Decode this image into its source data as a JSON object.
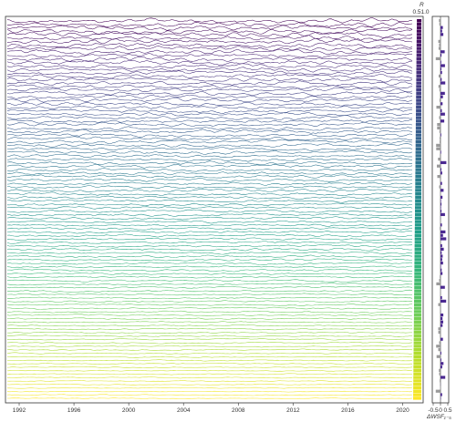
{
  "chart_data": [
    {
      "type": "line",
      "title": "",
      "xlabel": "",
      "ylabel": "",
      "x_ticks": [
        "1992",
        "1996",
        "2000",
        "2004",
        "2008",
        "2012",
        "2016",
        "2020"
      ],
      "x_range": [
        1991,
        2021.5
      ],
      "series_count": 110,
      "colormap": "viridis",
      "colormap_stops": [
        "#440154",
        "#482878",
        "#3e4989",
        "#31688e",
        "#26828e",
        "#1f9e89",
        "#35b779",
        "#6ece58",
        "#b5de2b",
        "#fde725"
      ]
    },
    {
      "type": "bar",
      "orientation": "horizontal",
      "title_label": "R",
      "ticks": [
        "0.5",
        "1.0"
      ],
      "xlim": [
        0.0,
        1.0
      ]
    },
    {
      "type": "bar",
      "orientation": "horizontal",
      "xlabel": "ΔWSF₁₋₅",
      "ticks": [
        "-0.5",
        "0",
        "0.5"
      ],
      "xlim": [
        -0.6,
        0.6
      ],
      "positive_color": "#4b2991",
      "negative_color": "#9a9a9a"
    }
  ]
}
